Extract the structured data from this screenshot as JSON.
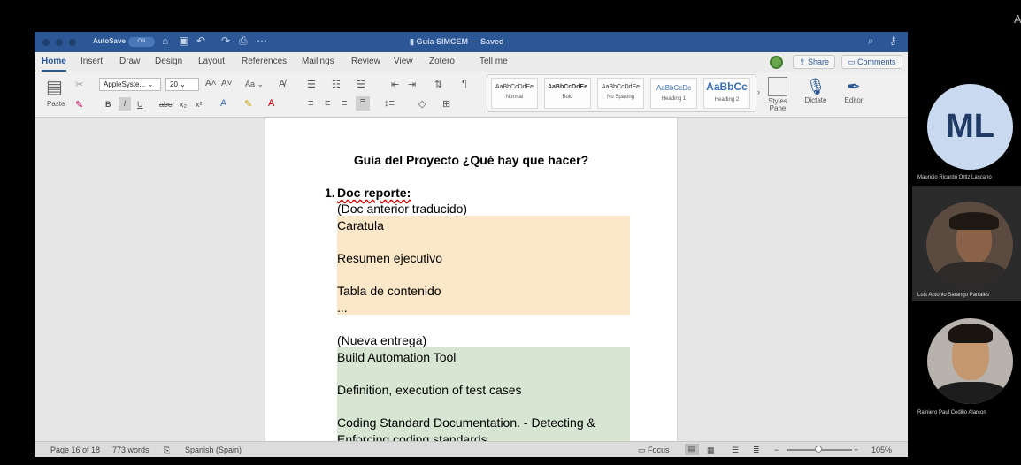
{
  "window": {
    "autosave_label": "AutoSave",
    "autosave_state": "ON",
    "title": "Guía SIMCEM",
    "title_status": "— Saved"
  },
  "tabs": [
    "Home",
    "Insert",
    "Draw",
    "Design",
    "Layout",
    "References",
    "Mailings",
    "Review",
    "View",
    "Zotero",
    "Tell me"
  ],
  "share_label": "Share",
  "comments_label": "Comments",
  "ribbon": {
    "paste_label": "Paste",
    "font_name": "AppleSyste...",
    "font_size": "20",
    "styles": [
      {
        "sample": "AaBbCcDdEe",
        "name": "Normal"
      },
      {
        "sample": "AaBbCcDdEe",
        "name": "Bold"
      },
      {
        "sample": "AaBbCcDdEe",
        "name": "No Spacing"
      },
      {
        "sample": "AaBbCcDc",
        "name": "Heading 1"
      },
      {
        "sample": "AaBbCc",
        "name": "Heading 2"
      }
    ],
    "styles_pane_label": "Styles Pane",
    "dictate_label": "Dictate",
    "editor_label": "Editor"
  },
  "document": {
    "title": "Guía del Proyecto ¿Qué hay que hacer?",
    "item_number": "1.",
    "item_heading": "Doc reporte:",
    "line1": "(Doc anterior traducido)",
    "line2": "Caratula",
    "line3": "Resumen ejecutivo",
    "line4": "Tabla de contenido",
    "line5": "...",
    "line6": "(Nueva entrega)",
    "line7": "Build Automation Tool",
    "line8": "Definition, execution of test cases",
    "line9": "Coding Standard Documentation. - Detecting &",
    "line10": "Enforcing coding standards"
  },
  "statusbar": {
    "page": "Page 16 of 18",
    "words": "773 words",
    "language": "Spanish (Spain)",
    "focus_label": "Focus",
    "zoom": "105%"
  },
  "participants": [
    {
      "initials": "ML",
      "name": "Mauricio Ricardo Ortiz Lascano"
    },
    {
      "name": "Luis Antonio Sarango Parrales"
    },
    {
      "name": "Rainiero Paul Cedillo Alarcon"
    }
  ],
  "corner_text": "A",
  "colors": {
    "titlebar": "#2b5797",
    "highlight_orange": "#fce7c8",
    "highlight_green": "#d7e6d2",
    "avatar_bg": "#c9d9ef",
    "avatar_text": "#1f3a64"
  }
}
